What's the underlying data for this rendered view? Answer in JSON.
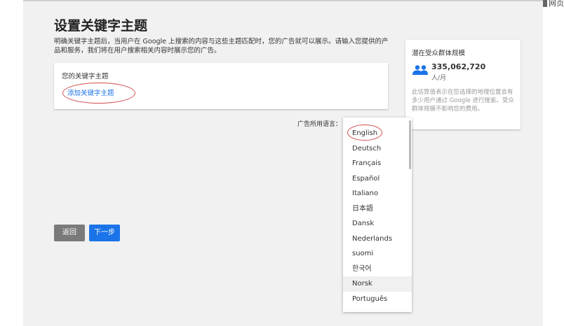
{
  "header": {
    "title": "设置关键字主题",
    "corner_text": "网页"
  },
  "description": "明确关键字主题后，当用户在 Google 上搜索的内容与这些主题匹配时，您的广告就可以展示。请输入您提供的产品和服务，我们将在用户搜索相关内容时展示您的广告。",
  "keywords": {
    "label": "您的关键字主题",
    "add_link": "添加关键字主题"
  },
  "audience": {
    "title": "潜在受众群体规模",
    "value": "335,062,720",
    "unit": "人/月",
    "description": "此估算值表示在您选择的地理位置会有多少用户通过 Google 进行搜索。受众群体规模不影响您的费用。"
  },
  "language": {
    "label": "广告所用语言：",
    "options": [
      "English",
      "Deutsch",
      "Français",
      "Español",
      "Italiano",
      "日本語",
      "Dansk",
      "Nederlands",
      "suomi",
      "한국어",
      "Norsk",
      "Português"
    ],
    "selected": "English",
    "hovered": "Norsk"
  },
  "buttons": {
    "back": "返回",
    "next": "下一步"
  },
  "colors": {
    "accent": "#1a73e8",
    "annotation": "#d24d4d",
    "back_button": "#7a7a7a"
  }
}
